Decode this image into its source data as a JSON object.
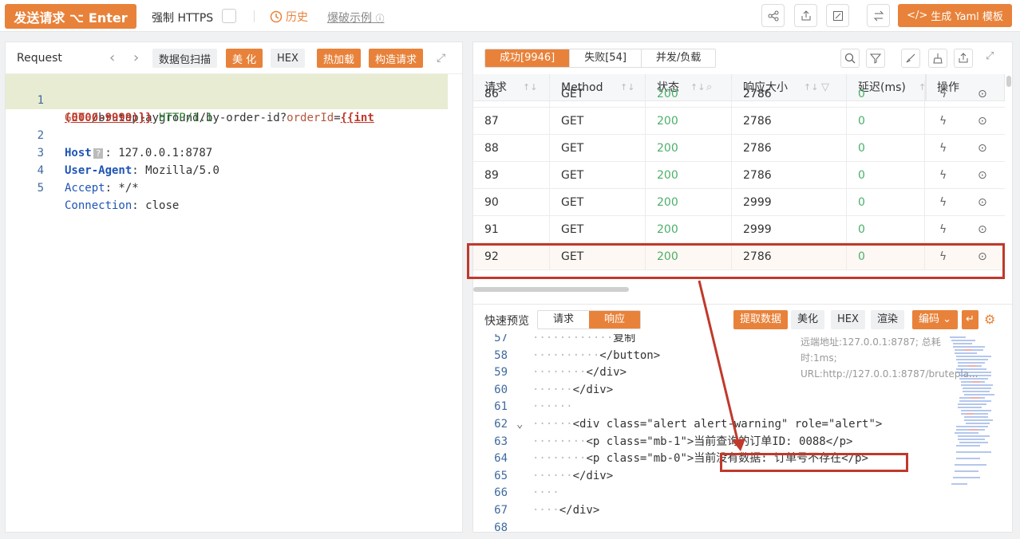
{
  "toolbar": {
    "send_label": "发送请求 ⌥ Enter",
    "https_label": "强制 HTTPS",
    "history_label": "历史",
    "brute_label": "爆破示例",
    "yaml_label": "生成 Yaml 模板"
  },
  "request": {
    "title": "Request",
    "buttons": {
      "scan": "数据包扫描",
      "beautify": "美 化",
      "hex": "HEX",
      "hotload": "热加载",
      "construct": "构造请求"
    },
    "lines": [
      {
        "num": "1",
        "method": "GET",
        "path": " /bruteplayground/by-order-id?",
        "param": "orderId",
        "eq": "=",
        "tpl": "{{int"
      },
      {
        "num": "",
        "tpl2": "(0000-9999)}}",
        "proto": " HTTP/1.1"
      },
      {
        "num": "2",
        "key": "Host",
        "badge": "?",
        "val": ": 127.0.0.1:8787"
      },
      {
        "num": "3",
        "key": "User-Agent",
        "val": ": Mozilla/5.0"
      },
      {
        "num": "4",
        "key": "Accept",
        "val": ": */*"
      },
      {
        "num": "5",
        "key": "Connection",
        "val": ": close"
      }
    ]
  },
  "results": {
    "tabs": [
      "成功[9946]",
      "失败[54]",
      "并发/负载"
    ],
    "columns": [
      "请求",
      "Method",
      "状态",
      "响应大小",
      "延迟(ms)",
      "操作"
    ],
    "rows": [
      {
        "id": "86",
        "method": "GET",
        "status": "200",
        "size": "2786",
        "delay": "0"
      },
      {
        "id": "87",
        "method": "GET",
        "status": "200",
        "size": "2786",
        "delay": "0"
      },
      {
        "id": "88",
        "method": "GET",
        "status": "200",
        "size": "2786",
        "delay": "0"
      },
      {
        "id": "89",
        "method": "GET",
        "status": "200",
        "size": "2786",
        "delay": "0"
      },
      {
        "id": "90",
        "method": "GET",
        "status": "200",
        "size": "2999",
        "delay": "0"
      },
      {
        "id": "91",
        "method": "GET",
        "status": "200",
        "size": "2999",
        "delay": "0"
      },
      {
        "id": "92",
        "method": "GET",
        "status": "200",
        "size": "2786",
        "delay": "0"
      }
    ]
  },
  "preview": {
    "title": "快速预览",
    "tabs": [
      "请求",
      "响应"
    ],
    "buttons": {
      "extract": "提取数据",
      "beautify": "美化",
      "hex": "HEX",
      "render": "渲染",
      "encoding": "编码"
    },
    "meta": "远端地址:127.0.0.1:8787; 总耗时:1ms; URL:http://127.0.0.1:8787/bruteplа...",
    "lines": [
      {
        "num": "57",
        "indent": "············",
        "text": "复制"
      },
      {
        "num": "58",
        "indent": "··········",
        "text": "</button>"
      },
      {
        "num": "59",
        "indent": "········",
        "text": "</div>"
      },
      {
        "num": "60",
        "indent": "······",
        "text": "</div>"
      },
      {
        "num": "61",
        "indent": "······",
        "text": ""
      },
      {
        "num": "62",
        "indent": "······",
        "text": "<div class=\"alert alert-warning\" role=\"alert\">"
      },
      {
        "num": "63",
        "indent": "········",
        "text": "<p class=\"mb-1\">当前查询的订单ID: 0088</p>"
      },
      {
        "num": "64",
        "indent": "········",
        "text": "<p class=\"mb-0\">当前没有数据: 订单号不存在</p>"
      },
      {
        "num": "65",
        "indent": "······",
        "text": "</div>"
      },
      {
        "num": "66",
        "indent": "····",
        "text": ""
      },
      {
        "num": "67",
        "indent": "····",
        "text": "</div>"
      },
      {
        "num": "68",
        "indent": "",
        "text": ""
      }
    ]
  },
  "colors": {
    "accent": "#e8823a",
    "highlight": "#c0392b",
    "status_ok": "#4caf6a"
  }
}
